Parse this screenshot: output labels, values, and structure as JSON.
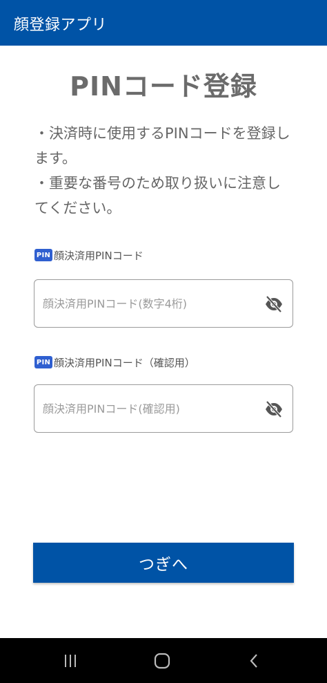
{
  "app_bar": {
    "title": "顔登録アプリ",
    "color": "#0053a6"
  },
  "page": {
    "title": "PINコード登録"
  },
  "description": {
    "line1": "・決済時に使用するPINコードを登録します。",
    "line2": "・重要な番号のため取り扱いに注意してください。"
  },
  "pin_field": {
    "badge": "PIN",
    "label": "顔決済用PINコード",
    "value": "",
    "placeholder": "顔決済用PINコード(数字4桁)",
    "toggle_icon": "eye-off-icon"
  },
  "pin_confirm_field": {
    "badge": "PIN",
    "label": "顔決済用PINコード（確認用）",
    "value": "",
    "placeholder": "顔決済用PINコード(確認用)",
    "toggle_icon": "eye-off-icon"
  },
  "next_button": {
    "label": "つぎへ"
  },
  "system_nav": {
    "icons": [
      "recent-apps-icon",
      "home-icon",
      "back-icon"
    ]
  }
}
